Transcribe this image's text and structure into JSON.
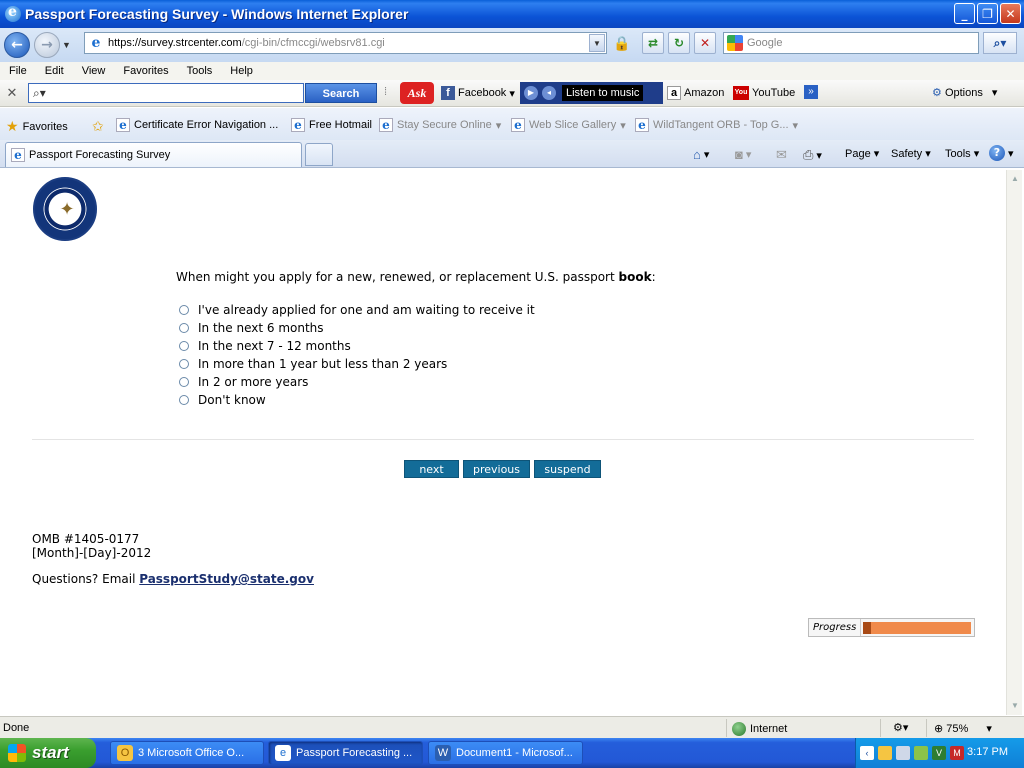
{
  "window": {
    "title": "Passport Forecasting Survey - Windows Internet Explorer"
  },
  "address": {
    "scheme": "https://",
    "domain": "survey.strcenter.com",
    "path": "/cgi-bin/cfmccgi/websrv81.cgi",
    "search_placeholder": "Google"
  },
  "menu": [
    "File",
    "Edit",
    "View",
    "Favorites",
    "Tools",
    "Help"
  ],
  "toolbar": {
    "search_button": "Search",
    "ask_label": "Ask",
    "facebook": "Facebook",
    "music": "Listen to music",
    "amazon": "Amazon",
    "youtube": "YouTube",
    "options": "Options"
  },
  "favorites": {
    "label": "Favorites",
    "items": [
      "Certificate Error Navigation ...",
      "Free Hotmail",
      "Stay Secure Online",
      "Web Slice Gallery",
      "WildTangent ORB - Top G..."
    ]
  },
  "tab": {
    "title": "Passport Forecasting Survey"
  },
  "commands": {
    "page": "Page",
    "safety": "Safety",
    "tools": "Tools"
  },
  "survey": {
    "question_pre": "When might you apply for a new, renewed, or replacement U.S. passport ",
    "question_bold": "book",
    "question_post": ":",
    "options": [
      "I've already applied for one and am waiting to receive it",
      "In the next 6 months",
      "In the next 7 - 12 months",
      "In more than 1 year but less than 2 years",
      "In 2 or more years",
      "Don't know"
    ],
    "buttons": {
      "next": "next",
      "previous": "previous",
      "suspend": "suspend"
    },
    "omb": "OMB #1405-0177",
    "date": "[Month]-[Day]-2012",
    "questions_label": "Questions? Email ",
    "email": "PassportStudy@state.gov",
    "progress_label": "Progress",
    "progress_fraction": 0.07
  },
  "status": {
    "text": "Done",
    "zone": "Internet",
    "zoom": "75%"
  },
  "taskbar": {
    "start": "start",
    "tasks": [
      "3 Microsoft Office O...",
      "Passport Forecasting ...",
      "Document1 - Microsof..."
    ],
    "clock": "3:17 PM"
  },
  "colors": {
    "button_blue": "#136c98",
    "progress_light": "#f08a4b",
    "progress_dark": "#a84a16",
    "title_blue": "#0b53d6"
  }
}
